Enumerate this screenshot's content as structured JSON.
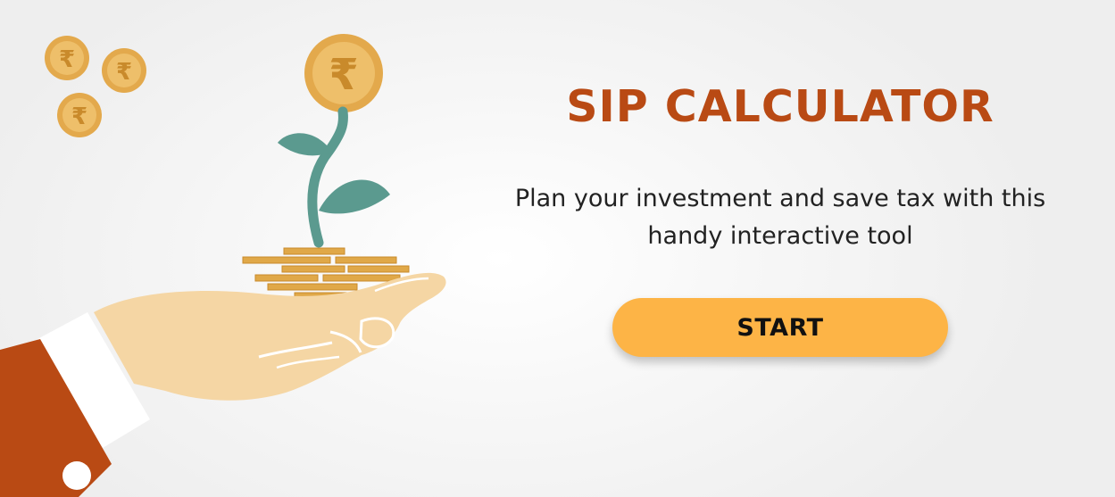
{
  "hero": {
    "title": "SIP CALCULATOR",
    "subtitle": "Plan your investment and save tax with this handy interactive tool",
    "start_label": "START"
  },
  "illustration": {
    "coin_symbol": "₹",
    "icon": "hand-holding-plant-coins-icon"
  },
  "colors": {
    "title": "#b94a14",
    "button": "#fdb446",
    "sleeve": "#b94a14",
    "coin": "#e3a94c",
    "leaf": "#5b9a8f",
    "hand": "#f5d6a4"
  }
}
